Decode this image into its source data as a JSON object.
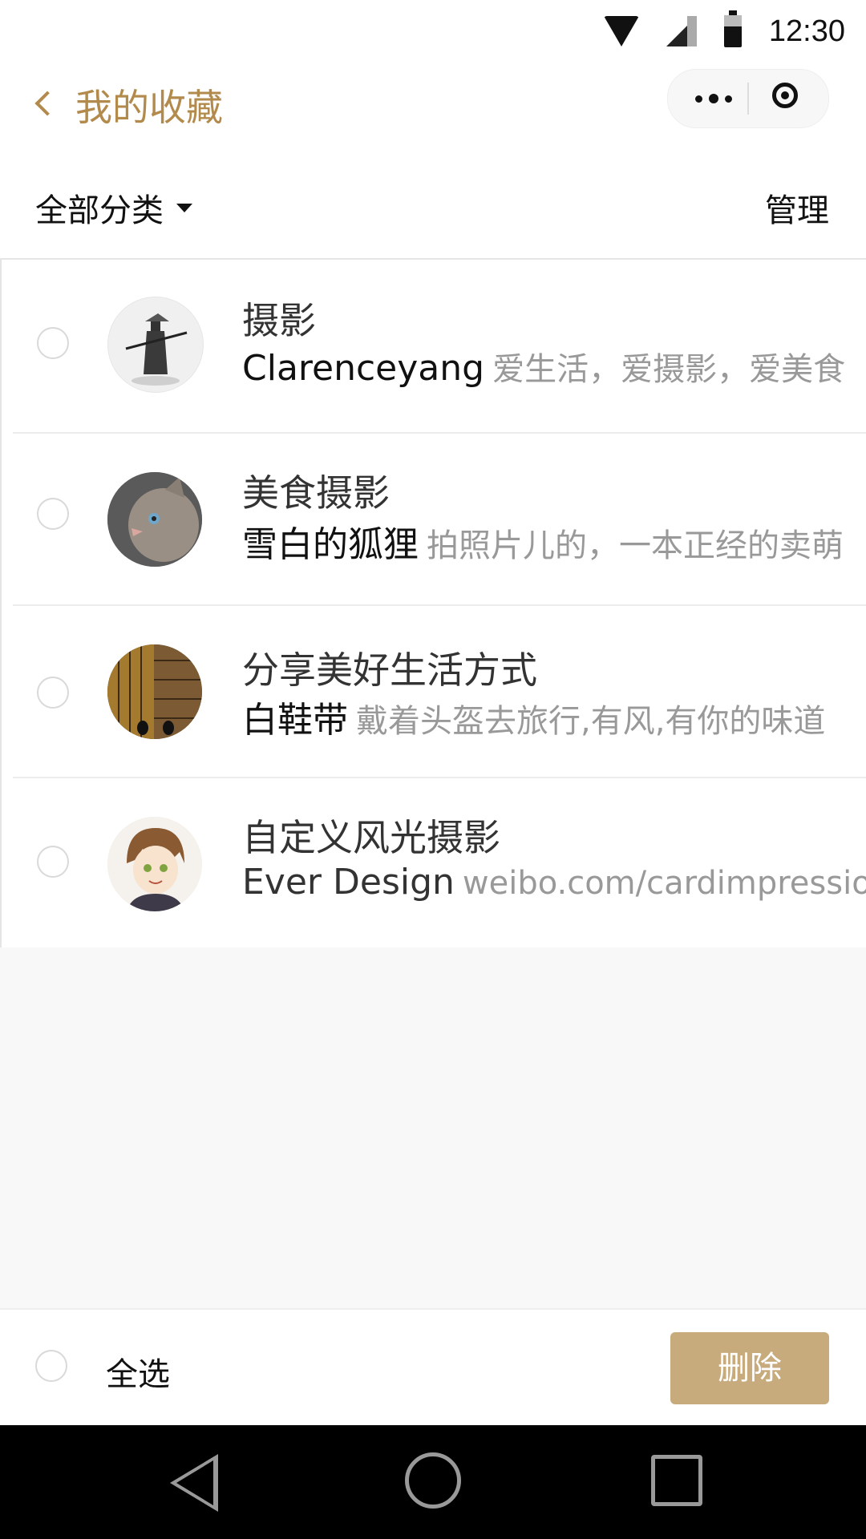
{
  "status_bar": {
    "time": "12:30"
  },
  "header": {
    "title": "我的收藏"
  },
  "filter": {
    "category_label": "全部分类",
    "manage_label": "管理"
  },
  "favorites": [
    {
      "title": "摄影",
      "author": "Clarenceyang",
      "desc": "爱生活，爱摄影，爱美食",
      "avatar": "samurai-avatar"
    },
    {
      "title": "美食摄影",
      "author": "雪白的狐狸",
      "desc": "拍照片儿的，一本正经的卖萌",
      "avatar": "cat-avatar"
    },
    {
      "title": "分享美好生活方式",
      "author": "白鞋带",
      "desc": "戴着头盔去旅行,有风,有你的味道",
      "avatar": "floor-avatar"
    },
    {
      "title": "自定义风光摄影",
      "author": "Ever Design",
      "desc": "weibo.com/cardimpression",
      "avatar": "anime-avatar"
    }
  ],
  "footer": {
    "select_all_label": "全选",
    "delete_label": "删除"
  },
  "colors": {
    "accent": "#b28a4c",
    "delete_button": "#c8ab7c"
  }
}
